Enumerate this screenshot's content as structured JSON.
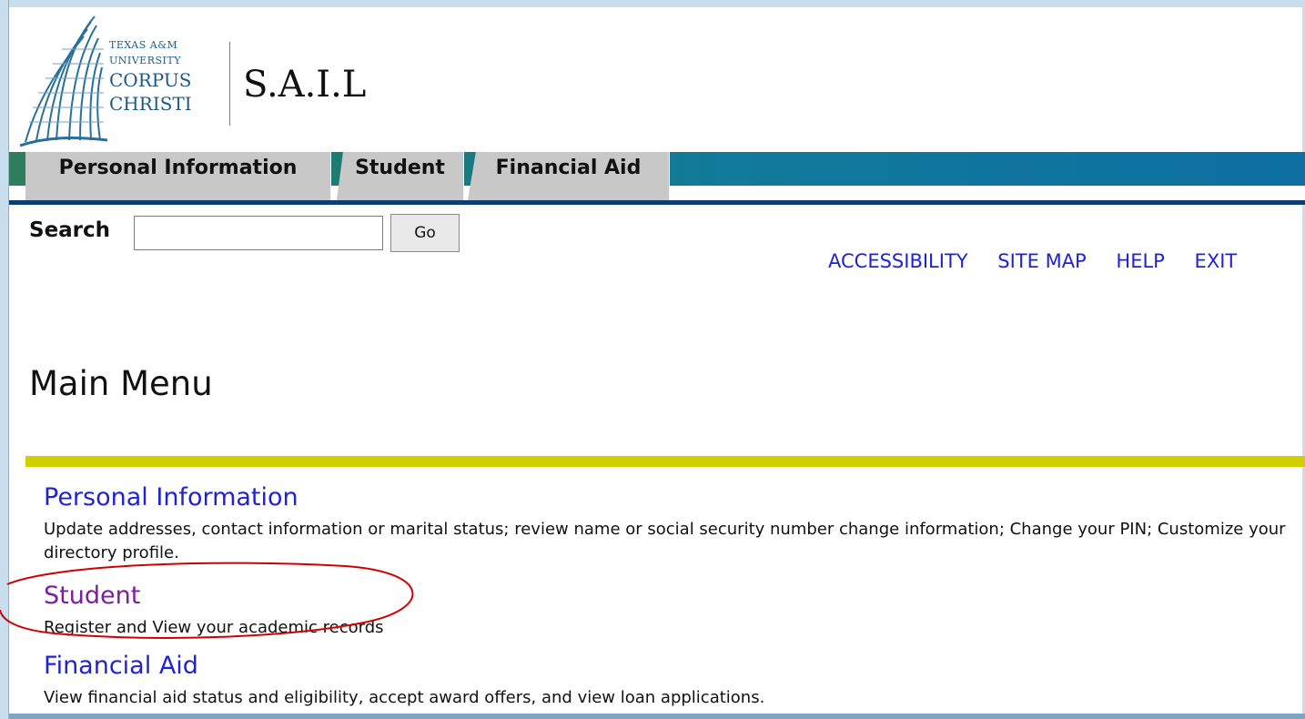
{
  "logo": {
    "university_line1": "TEXAS A&M",
    "university_line2": "UNIVERSITY",
    "university_line3": "CORPUS",
    "university_line4": "CHRISTI",
    "app_name": "S.A.I.L"
  },
  "tabs": [
    {
      "label": "Personal Information"
    },
    {
      "label": "Student"
    },
    {
      "label": "Financial Aid"
    }
  ],
  "search": {
    "label": "Search",
    "value": "",
    "button_label": "Go"
  },
  "top_links": [
    "ACCESSIBILITY",
    "SITE MAP",
    "HELP",
    "EXIT"
  ],
  "page_title": "Main Menu",
  "menu": [
    {
      "title": "Personal Information",
      "description": "Update addresses, contact information or marital status; review name or social security number change information; Change your PIN; Customize your directory profile."
    },
    {
      "title": "Student",
      "description": "Register and View your academic records"
    },
    {
      "title": "Financial Aid",
      "description": "View financial aid status and eligibility, accept award offers, and view loan applications."
    }
  ],
  "colors": {
    "link": "#1f23d6",
    "visited_link": "#7a1fa0",
    "rule": "#d0cf02",
    "tab_bg": "#c8c8c8",
    "annotation": "#d00000"
  }
}
